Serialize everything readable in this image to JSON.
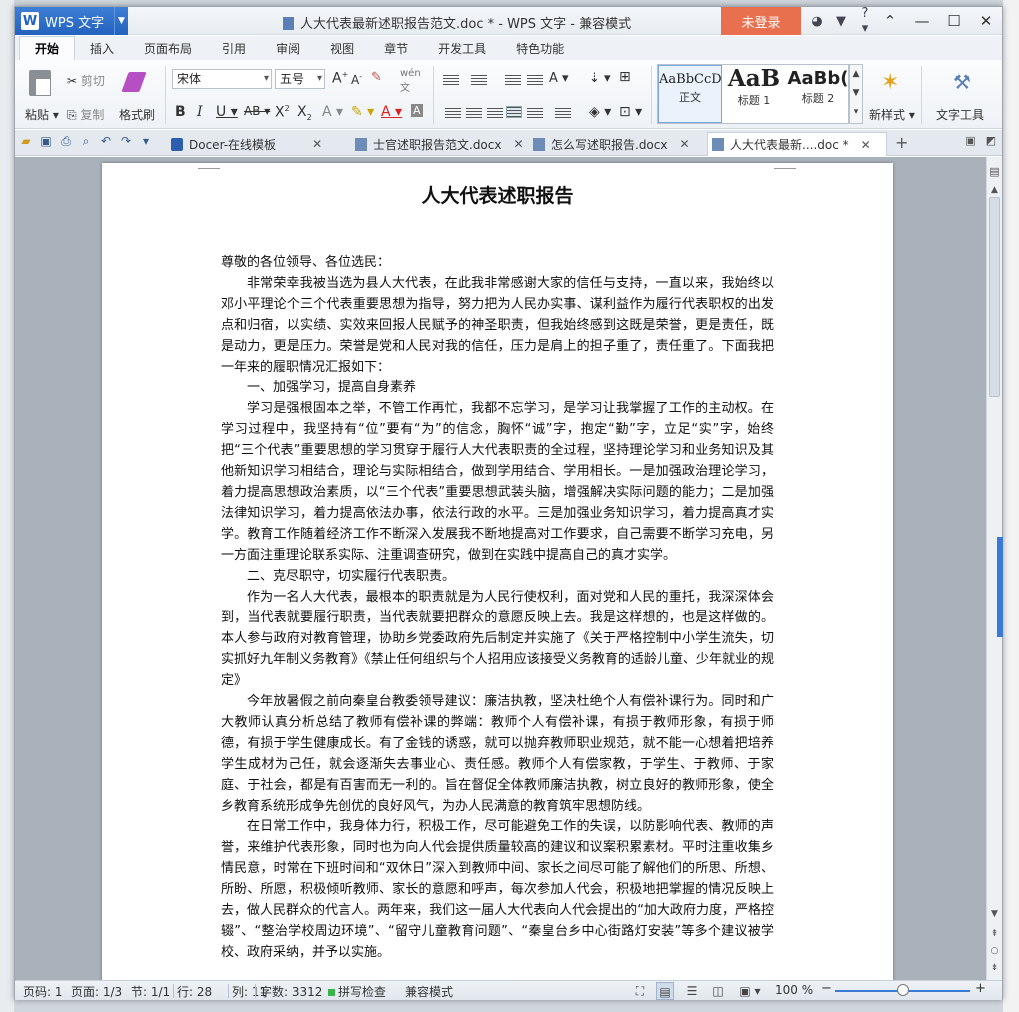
{
  "app": {
    "menu_label": "WPS 文字",
    "window_title": "人大代表最新述职报告范文.doc * - WPS 文字 - 兼容模式",
    "login_label": "未登录",
    "help_label": "?"
  },
  "ribbon_tabs": [
    "开始",
    "插入",
    "页面布局",
    "引用",
    "审阅",
    "视图",
    "章节",
    "开发工具",
    "特色功能"
  ],
  "ribbon": {
    "paste": "粘贴",
    "cut": "剪切",
    "copy": "复制",
    "format_painter": "格式刷",
    "font_name": "宋体",
    "font_size": "五号",
    "styles": [
      {
        "sample": "AaBbCcD",
        "name": "正文"
      },
      {
        "sample": "AaB",
        "name": "标题 1"
      },
      {
        "sample": "AaBb(",
        "name": "标题 2"
      }
    ],
    "new_style": "新样式",
    "text_tools": "文字工具"
  },
  "doc_tabs": [
    {
      "label": "Docer-在线模板",
      "active": false
    },
    {
      "label": "士官述职报告范文.docx",
      "active": false
    },
    {
      "label": "怎么写述职报告.docx",
      "active": false
    },
    {
      "label": "人大代表最新....doc *",
      "active": true
    }
  ],
  "document": {
    "title": "人大代表述职报告",
    "paragraphs": [
      {
        "text": "尊敬的各位领导、各位选民：",
        "indent": false
      },
      {
        "text": "非常荣幸我被当选为县人大代表，在此我非常感谢大家的信任与支持，一直以来，我始终以邓小平理论个三个代表重要思想为指导，努力把为人民办实事、谋利益作为履行代表职权的出发点和归宿，以实绩、实效来回报人民赋予的神圣职责，但我始终感到这既是荣誉，更是责任，既是动力，更是压力。荣誉是党和人民对我的信任，压力是肩上的担子重了，责任重了。下面我把一年来的履职情况汇报如下：",
        "indent": true
      },
      {
        "text": "一、加强学习，提高自身素养",
        "indent": true
      },
      {
        "text": "学习是强根固本之举，不管工作再忙，我都不忘学习，是学习让我掌握了工作的主动权。在学习过程中，我坚持有“位”要有“为”的信念，胸怀“诚”字，抱定“勤”字，立足“实”字，始终把“三个代表”重要思想的学习贯穿于履行人大代表职责的全过程，坚持理论学习和业务知识及其他新知识学习相结合，理论与实际相结合，做到学用结合、学用相长。一是加强政治理论学习，着力提高思想政治素质，以“三个代表”重要思想武装头脑，增强解决实际问题的能力；二是加强法律知识学习，着力提高依法办事，依法行政的水平。三是加强业务知识学习，着力提高真才实学。教育工作随着经济工作不断深入发展我不断地提高对工作要求，自己需要不断学习充电，另一方面注重理论联系实际、注重调查研究，做到在实践中提高自己的真才实学。",
        "indent": true
      },
      {
        "text": "二、克尽职守，切实履行代表职责。",
        "indent": true
      },
      {
        "text": "作为一名人大代表，最根本的职责就是为人民行使权利，面对党和人民的重托，我深深体会到，当代表就要履行职责，当代表就要把群众的意愿反映上去。我是这样想的，也是这样做的。本人参与政府对教育管理，协助乡党委政府先后制定并实施了《关于严格控制中小学生流失，切实抓好九年制义务教育》《禁止任何组织与个人招用应该接受义务教育的适龄儿童、少年就业的规定》",
        "indent": true
      },
      {
        "text": "今年放暑假之前向秦皇台教委领导建议：廉洁执教，坚决杜绝个人有偿补课行为。同时和广大教师认真分析总结了教师有偿补课的弊端：教师个人有偿补课，有损于教师形象，有损于师德，有损于学生健康成长。有了金钱的诱惑，就可以抛弃教师职业规范，就不能一心想着把培养学生成材为己任，就会逐渐失去事业心、责任感。教师个人有偿家教，于学生、于教师、于家庭、于社会，都是有百害而无一利的。旨在督促全体教师廉洁执教，树立良好的教师形象，使全乡教育系统形成争先创优的良好风气，为办人民满意的教育筑牢思想防线。",
        "indent": true
      },
      {
        "text": "在日常工作中，我身体力行，积极工作，尽可能避免工作的失误，以防影响代表、教师的声誉，来维护代表形象，同时也为向人代会提供质量较高的建议和议案积累素材。平时注重收集乡情民意，时常在下班时间和“双休日”深入到教师中间、家长之间尽可能了解他们的所思、所想、所盼、所愿，积极倾听教师、家长的意愿和呼声，每次参加人代会，积极地把掌握的情况反映上去，做人民群众的代言人。两年来，我们这一届人大代表向人代会提出的“加大政府力度，严格控辍”、“整治学校周边环境”、“留守儿童教育问题”、“秦皇台乡中心街路灯安装”等多个建议被学校、政府采纳，并予以实施。",
        "indent": true
      }
    ]
  },
  "status_bar": {
    "page_code": "页码: 1",
    "pages": "页面: 1/3",
    "section": "节: 1/1",
    "row": "行: 28",
    "column": "列: 11",
    "word_count": "字数: 3312",
    "spell_check": "拼写检查",
    "compat_mode": "兼容模式",
    "zoom": "100 %",
    "zoom_percent": 100
  },
  "colors": {
    "app_blue": "#2463bd",
    "login_orange": "#e8704f",
    "scroll_accent": "#3a7bd5"
  }
}
